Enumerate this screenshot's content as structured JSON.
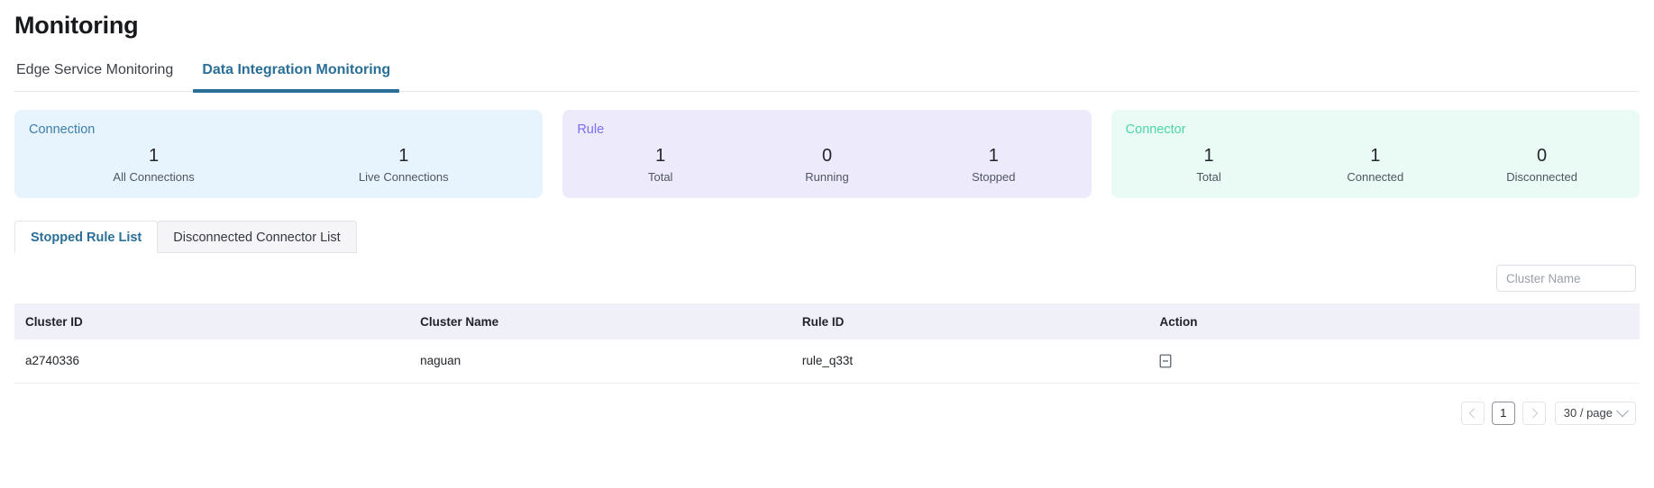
{
  "page": {
    "title": "Monitoring"
  },
  "top_tabs": [
    {
      "label": "Edge Service Monitoring",
      "active": false
    },
    {
      "label": "Data Integration Monitoring",
      "active": true
    }
  ],
  "stat_cards": [
    {
      "title": "Connection",
      "accent": "#3d7ea8",
      "background": "#e8f4fd",
      "metrics": [
        {
          "value": "1",
          "label": "All Connections"
        },
        {
          "value": "1",
          "label": "Live Connections"
        }
      ]
    },
    {
      "title": "Rule",
      "accent": "#7c6ef0",
      "background": "#edeafb",
      "metrics": [
        {
          "value": "1",
          "label": "Total"
        },
        {
          "value": "0",
          "label": "Running"
        },
        {
          "value": "1",
          "label": "Stopped"
        }
      ]
    },
    {
      "title": "Connector",
      "accent": "#4ed6a4",
      "background": "#e9fbf4",
      "metrics": [
        {
          "value": "1",
          "label": "Total"
        },
        {
          "value": "1",
          "label": "Connected"
        },
        {
          "value": "0",
          "label": "Disconnected"
        }
      ]
    }
  ],
  "card_tabs": [
    {
      "label": "Stopped Rule List",
      "active": true
    },
    {
      "label": "Disconnected Connector List",
      "active": false
    }
  ],
  "search": {
    "placeholder": "Cluster Name",
    "value": ""
  },
  "table": {
    "columns": [
      "Cluster ID",
      "Cluster Name",
      "Rule ID",
      "Action"
    ],
    "rows": [
      {
        "cluster_id": "a2740336",
        "cluster_name": "naguan",
        "rule_id": "rule_q33t",
        "action_icon": "document-list-icon"
      }
    ]
  },
  "pagination": {
    "prev_icon": "chevron-left-icon",
    "next_icon": "chevron-right-icon",
    "current_page": "1",
    "page_size_label": "30 / page",
    "page_size_icon": "chevron-down-icon"
  }
}
